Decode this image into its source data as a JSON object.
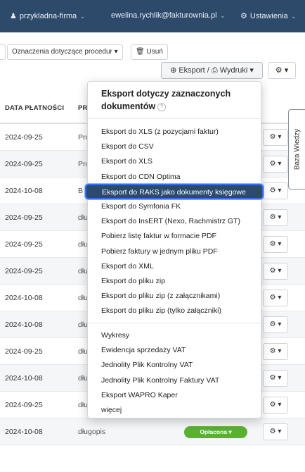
{
  "topbar": {
    "company": "przykladna-firma",
    "user": "ewelina.rychlik@fakturownia.pl",
    "settings": "Ustawienia"
  },
  "toolbar": {
    "procedures": "Oznaczenia dotyczące procedur",
    "delete": "Usuń",
    "export": "Eksport / ",
    "prints": "Wydruki"
  },
  "table": {
    "headers": {
      "payment_date": "DATA PŁATNOŚCI",
      "product": "PR"
    },
    "rows": [
      {
        "date": "2024-09-25",
        "product": "Pro"
      },
      {
        "date": "2024-09-25",
        "product": "Pro"
      },
      {
        "date": "2024-10-08",
        "product": "B"
      },
      {
        "date": "2024-09-25",
        "product": "dłu"
      },
      {
        "date": "2024-09-25",
        "product": "dłu"
      },
      {
        "date": "2024-09-25",
        "product": "dłu"
      },
      {
        "date": "2024-10-08",
        "product": "dłu"
      },
      {
        "date": "2024-10-08",
        "product": "dłu"
      },
      {
        "date": "2024-09-25",
        "product": "dłu"
      },
      {
        "date": "2024-10-08",
        "product": "dłu"
      },
      {
        "date": "2024-09-25",
        "product": "długopis"
      },
      {
        "date": "2024-10-08",
        "product": "długopis",
        "status": "Opłacona"
      }
    ]
  },
  "dropdown": {
    "header": "Eksport dotyczy zaznaczonych dokumentów",
    "help": "?",
    "group1": [
      "Eksport do XLS (z pozycjami faktur)",
      "Eksport do CSV",
      "Eksport do XLS",
      "Eksport do CDN Optima",
      "Eksport do RAKS jako dokumenty księgowe",
      "Eksport do Symfonia FK",
      "Eksport do InsERT (Nexo, Rachmistrz GT)",
      "Pobierz listę faktur w formacie PDF",
      "Pobierz faktury w jednym pliku PDF",
      "Eksport do XML",
      "Eksport do pliku zip",
      "Eksport do pliku zip (z załącznikami)",
      "Eksport do pliku zip (tylko załączniki)"
    ],
    "group2": [
      "Wykresy",
      "Ewidencja sprzedaży VAT",
      "Jednolity Plik Kontrolny VAT",
      "Jednolity Plik Kontrolny Faktury VAT",
      "Eksport WAPRO Kaper",
      "więcej"
    ]
  },
  "side_tab": "Baza Wiedzy",
  "colors": {
    "topbar": "#2d4a6b",
    "status_paid": "#5ab031",
    "highlight": "#2c4a69",
    "highlight_border": "#2f6ff0"
  }
}
